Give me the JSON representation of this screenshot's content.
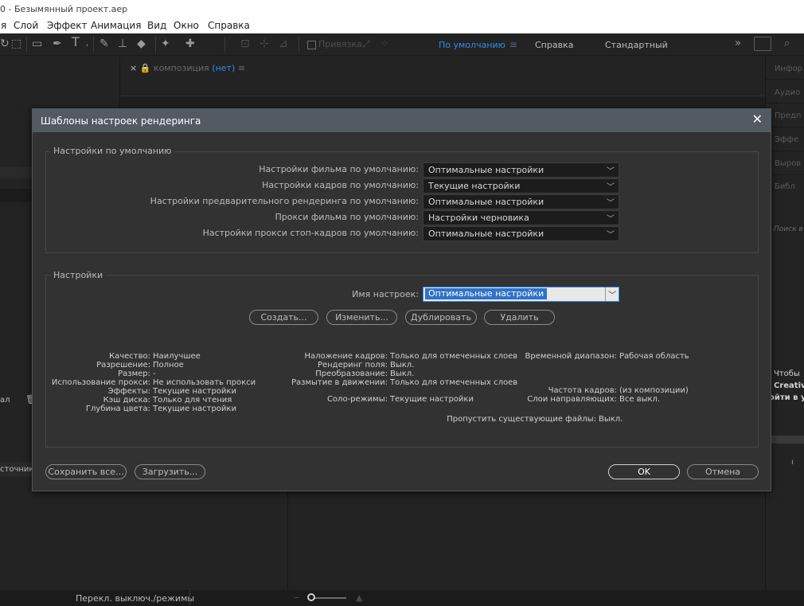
{
  "window": {
    "title": "0 - Безымянный проект.aep"
  },
  "menubar": [
    "я",
    "Слой",
    "Эффект",
    "Анимация",
    "Вид",
    "Окно",
    "Справка"
  ],
  "toolbar": {
    "snap_label": "Привязка",
    "workspaces": [
      {
        "label": "По умолчанию",
        "active": true
      },
      {
        "label": "Справка",
        "active": false
      },
      {
        "label": "Стандартный",
        "active": false
      }
    ],
    "overflow": "»"
  },
  "composition_tab": {
    "close": "×",
    "prefix": "композиция",
    "name": "(нет)",
    "menu": "≡"
  },
  "right_panel": {
    "items": [
      "Инфор",
      "Аудио",
      "Предп",
      "Эффе",
      "Выров",
      "Библ"
    ],
    "search": "Поиск в",
    "message_lines": [
      "Чтобы",
      "Creative",
      "ойти в у"
    ]
  },
  "left_fragments": {
    "row1": "ал",
    "row2": "сточника"
  },
  "status_bar": {
    "label": "Перекл. выключ./режимы"
  },
  "dialog": {
    "title": "Шаблоны настроек рендеринга",
    "close": "✕",
    "defaults_group": {
      "title": "Настройки по умолчанию",
      "rows": [
        {
          "label": "Настройки фильма по умолчанию:",
          "value": "Оптимальные настройки"
        },
        {
          "label": "Настройки кадров по умолчанию:",
          "value": "Текущие настройки"
        },
        {
          "label": "Настройки предварительного рендеринга по умолчанию:",
          "value": "Оптимальные настройки"
        },
        {
          "label": "Прокси фильма по умолчанию:",
          "value": "Настройки черновика"
        },
        {
          "label": "Настройки прокси стоп-кадров по умолчанию:",
          "value": "Оптимальные настройки"
        }
      ]
    },
    "settings_group": {
      "title": "Настройки",
      "name_label": "Имя настроек:",
      "name_value": "Оптимальные настройки",
      "buttons": [
        "Создать...",
        "Изменить...",
        "Дублировать",
        "Удалить"
      ],
      "info_col1": [
        {
          "k": "Качество:",
          "v": "Наилучшее"
        },
        {
          "k": "Разрешение:",
          "v": "Полное"
        },
        {
          "k": "Размер:",
          "v": "-"
        },
        {
          "k": "Использование прокси:",
          "v": "Не использовать прокси"
        },
        {
          "k": "Эффекты:",
          "v": "Текущие настройки"
        },
        {
          "k": "Кэш диска:",
          "v": "Только для чтения"
        },
        {
          "k": "Глубина цвета:",
          "v": "Текущие настройки"
        }
      ],
      "info_col2": [
        {
          "k": "Наложение кадров:",
          "v": "Только для отмеченных слоев"
        },
        {
          "k": "Рендеринг поля:",
          "v": "Выкл."
        },
        {
          "k": "Преобразование:",
          "v": "Выкл."
        },
        {
          "k": "Размытие в движении:",
          "v": "Только для отмеченных слоев"
        }
      ],
      "solo": {
        "k": "Соло-режимы:",
        "v": "Текущие настройки"
      },
      "time_range": {
        "k": "Временной диапазон:",
        "v": "Рабочая область"
      },
      "frame_rate": {
        "k": "Частота кадров:",
        "v": "(из композиции)"
      },
      "guide_layers": {
        "k": "Слои направляющих:",
        "v": "Все выкл."
      },
      "skip_existing": {
        "k": "Пропустить существующие файлы:",
        "v": "Выкл."
      }
    },
    "footer": {
      "save_all": "Сохранить все...",
      "load": "Загрузить...",
      "ok": "OK",
      "cancel": "Отмена"
    }
  }
}
